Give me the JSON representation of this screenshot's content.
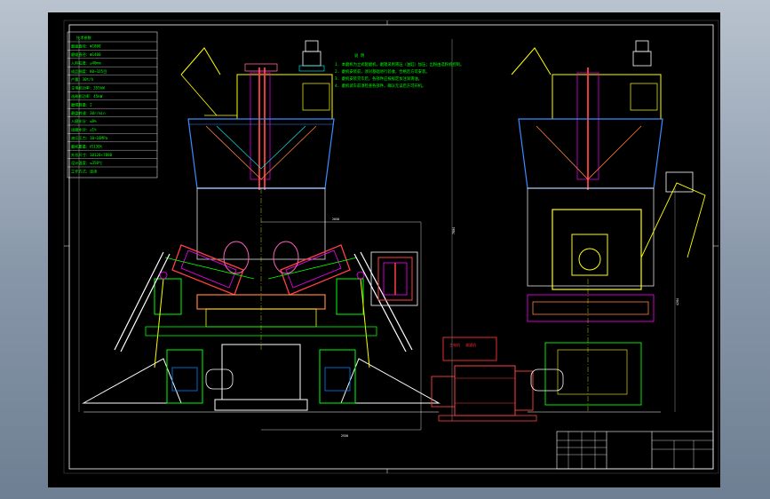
{
  "drawing": {
    "notes_title": "说 明",
    "notes": [
      "1. 本磨机为立式辊磨机，磨辊采用液压（油缸）加压；出粉由选粉机控制。",
      "2. 磨机安装前，须对基础进行验收，合格后方可安装。",
      "3. 磨机安装完毕后，各部件应按规定加注润滑油。",
      "4. 磨机试车前须检查各部件，确认无误后方可开机。"
    ],
    "spec_title": "技术参数",
    "spec_rows": [
      "磨盘直径：Φ1800",
      "磨辊直径：Φ1400",
      "入料粒度：≤40mm",
      "成品细度：80~325目",
      "产量：30t/h",
      "主电机功率：355kW",
      "选粉机功率：45kW",
      "磨辊数量：2",
      "磨盘转速：30r/min",
      "入磨水分：≤8%",
      "出磨水分：≤1%",
      "液压压力：10~16MPa",
      "磨机重量：约130t",
      "外形尺寸：10120×7880",
      "设计温度：≤350℃",
      "工作方式：连续"
    ],
    "motor_label_1": "主电机",
    "motor_label_2": "减速机",
    "dim_labels": [
      "7884",
      "2050",
      "2550",
      "4284"
    ],
    "title_block": {
      "row1": [
        "",
        "",
        "",
        "",
        ""
      ],
      "row2": [
        "",
        "",
        "",
        "",
        ""
      ]
    }
  }
}
